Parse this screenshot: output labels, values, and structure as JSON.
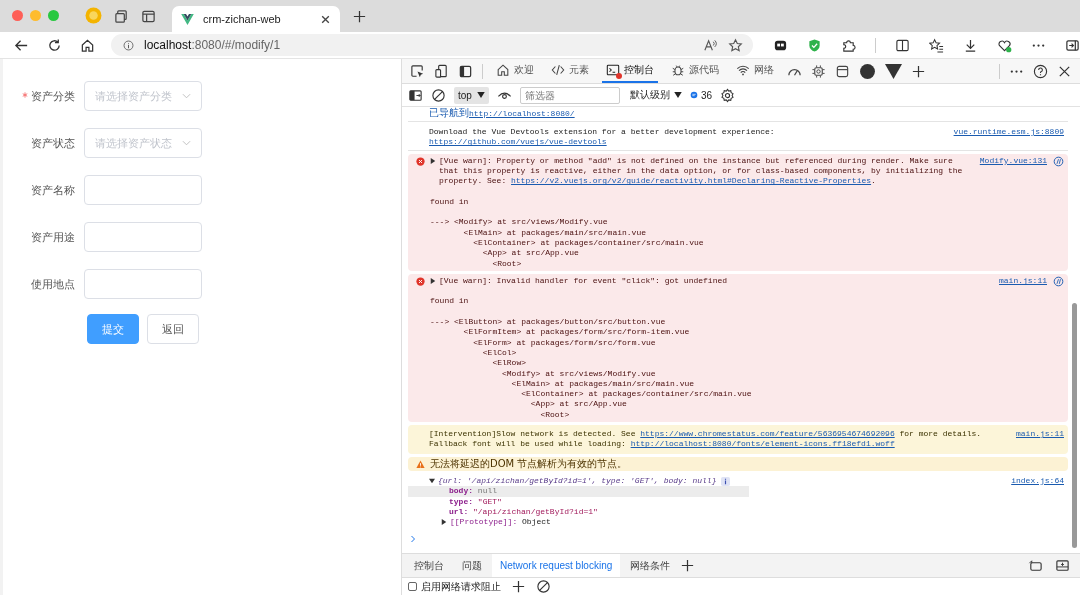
{
  "browser": {
    "tab_title": "crm-zichan-web",
    "url_host": "localhost",
    "url_path": ":8080/#/modify/1"
  },
  "form": {
    "fields": [
      {
        "label": "资产分类",
        "required": true,
        "kind": "select",
        "placeholder": "请选择资产分类"
      },
      {
        "label": "资产状态",
        "required": false,
        "kind": "select",
        "placeholder": "请选择资产状态"
      },
      {
        "label": "资产名称",
        "required": false,
        "kind": "input"
      },
      {
        "label": "资产用途",
        "required": false,
        "kind": "input"
      },
      {
        "label": "使用地点",
        "required": false,
        "kind": "input"
      }
    ],
    "buttons": [
      {
        "label": "提交",
        "primary": true
      },
      {
        "label": "返回",
        "primary": false
      }
    ]
  },
  "devtools": {
    "tabs": [
      {
        "label": "欢迎",
        "kind": "welcome",
        "selected": false,
        "error_badge": false
      },
      {
        "label": "元素",
        "kind": "elements",
        "selected": false,
        "error_badge": false
      },
      {
        "label": "控制台",
        "kind": "console",
        "selected": true,
        "error_badge": true
      },
      {
        "label": "源代码",
        "kind": "sources",
        "selected": false,
        "error_badge": false
      },
      {
        "label": "网络",
        "kind": "network",
        "selected": false,
        "error_badge": false
      }
    ],
    "toolbar": {
      "context": "top",
      "filter_placeholder": "筛选器",
      "levels": "默认级别",
      "issues_count": "36"
    },
    "messages": [
      {
        "kind": "nav",
        "paragraphs": [
          [
            {
              "text": "已导航到"
            },
            {
              "text": "http://localhost:8080/",
              "link": true
            }
          ]
        ]
      },
      {
        "kind": "log",
        "paragraphs": [
          [
            {
              "text": "Download the Vue Devtools extension for a better development experience: "
            },
            {
              "text": "https://github.com/vuejs/vue-devtools",
              "link": true
            }
          ]
        ],
        "source": "vue.runtime.esm.js:8809"
      },
      {
        "kind": "error",
        "expanded": false,
        "paragraphs": [
          [
            {
              "text": "[Vue warn]: Property or method \"add\" is not defined on the instance but referenced during render. Make sure that this property is reactive, either in the data option, or for class-based components, by initializing the property. See: "
            },
            {
              "text": "https://v2.vuejs.org/v2/guide/reactivity.html#Declaring-Reactive-Properties",
              "link": true
            },
            {
              "text": "."
            }
          ]
        ],
        "found_in": "found in",
        "trace": [
          {
            "text": "---> <Modify> at src/views/Modify.vue",
            "children": [
              {
                "text": "<ElMain> at packages/main/src/main.vue",
                "children": [
                  {
                    "text": "<ElContainer> at packages/container/src/main.vue",
                    "children": [
                      {
                        "text": "<App> at src/App.vue",
                        "children": [
                          {
                            "text": "<Root>"
                          }
                        ]
                      }
                    ]
                  }
                ]
              }
            ]
          }
        ],
        "source": "Modify.vue:131"
      },
      {
        "kind": "error",
        "expanded": false,
        "paragraphs": [
          [
            {
              "text": "[Vue warn]: Invalid handler for event \"click\": got undefined"
            }
          ]
        ],
        "found_in": "found in",
        "trace": [
          {
            "text": "---> <ElButton> at packages/button/src/button.vue",
            "children": [
              {
                "text": "<ElFormItem> at packages/form/src/form-item.vue",
                "children": [
                  {
                    "text": "<ElForm> at packages/form/src/form.vue",
                    "children": [
                      {
                        "text": "<ElCol>",
                        "children": [
                          {
                            "text": "<ElRow>",
                            "children": [
                              {
                                "text": "<Modify> at src/views/Modify.vue",
                                "children": [
                                  {
                                    "text": "<ElMain> at packages/main/src/main.vue",
                                    "children": [
                                      {
                                        "text": "<ElContainer> at packages/container/src/main.vue",
                                        "children": [
                                          {
                                            "text": "<App> at src/App.vue",
                                            "children": [
                                              {
                                                "text": "<Root>"
                                              }
                                            ]
                                          }
                                        ]
                                      }
                                    ]
                                  }
                                ]
                              }
                            ]
                          }
                        ]
                      }
                    ]
                  }
                ]
              }
            ]
          }
        ],
        "source": "main.js:11"
      },
      {
        "kind": "intervention",
        "paragraphs": [
          [
            {
              "text": "[Intervention]Slow network is detected. See "
            },
            {
              "text": "https://www.chromestatus.com/feature/5636954674692096",
              "link": true
            },
            {
              "text": " for more details. Fallback font will be used while loading: "
            },
            {
              "text": "http://localhost:8080/fonts/element-icons.ff18efd1.woff",
              "link": true
            }
          ]
        ],
        "source": "main.js:11"
      },
      {
        "kind": "warning",
        "paragraphs": [
          [
            {
              "text": "无法将延迟的DOM 节点解析为有效的节点。"
            }
          ]
        ]
      },
      {
        "kind": "object",
        "expanded": true,
        "summary": "{url: '/api/zichan/getById?id=1', type: 'GET', body: null}",
        "props": [
          {
            "key": "body:",
            "value": "null",
            "kind": "null",
            "highlighted": true
          },
          {
            "key": "type:",
            "value": "\"GET\"",
            "kind": "string",
            "highlighted": false
          },
          {
            "key": "url:",
            "value": "\"/api/zichan/getById?id=1\"",
            "kind": "string",
            "highlighted": false
          }
        ],
        "proto": {
          "key": "[[Prototype]]:",
          "value": "Object",
          "expanded": false
        },
        "source": "index.js:64"
      }
    ]
  },
  "drawer": {
    "tabs": [
      {
        "label": "控制台",
        "selected": false
      },
      {
        "label": "问题",
        "selected": false
      },
      {
        "label": "Network request blocking",
        "selected": true
      },
      {
        "label": "网络条件",
        "selected": false
      }
    ],
    "checkbox": {
      "label": "启用网络请求阻止",
      "checked": false
    }
  }
}
